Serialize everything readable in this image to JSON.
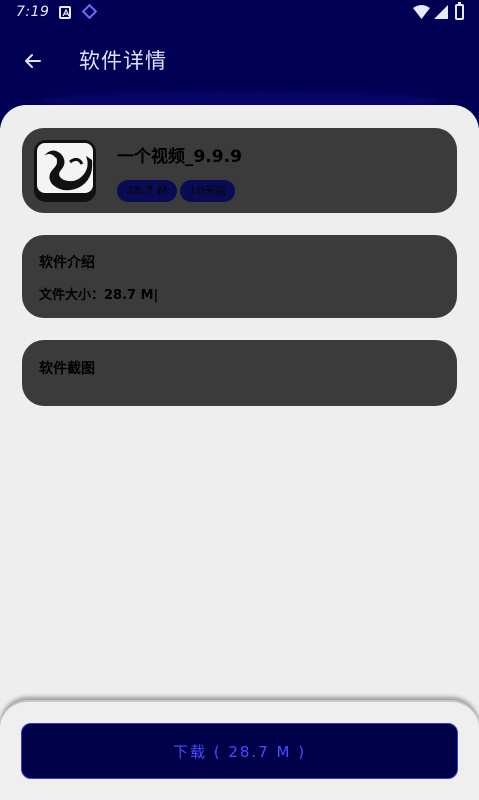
{
  "status_bar": {
    "time": "7:19",
    "icons": [
      "notification-a-icon",
      "diamond-icon",
      "wifi-icon",
      "signal-icon",
      "battery-icon"
    ]
  },
  "header": {
    "title": "软件详情",
    "back_icon": "arrow-left-icon"
  },
  "app": {
    "name": "一个视频_9.9.9",
    "size_badge": "28.7 M",
    "updated_badge": "10天前",
    "icon": "yin-yang-app-icon"
  },
  "intro": {
    "title": "软件介绍",
    "file_size": "文件大小：28.7 M|"
  },
  "screenshots": {
    "title": "软件截图"
  },
  "download": {
    "label": "下载 ( 28.7 M )"
  },
  "colors": {
    "header_bg": "#020054",
    "card_bg": "#3b3b3b",
    "page_bg": "#eeeeee",
    "button_bg": "#01014a",
    "button_text": "#4b4bff"
  }
}
